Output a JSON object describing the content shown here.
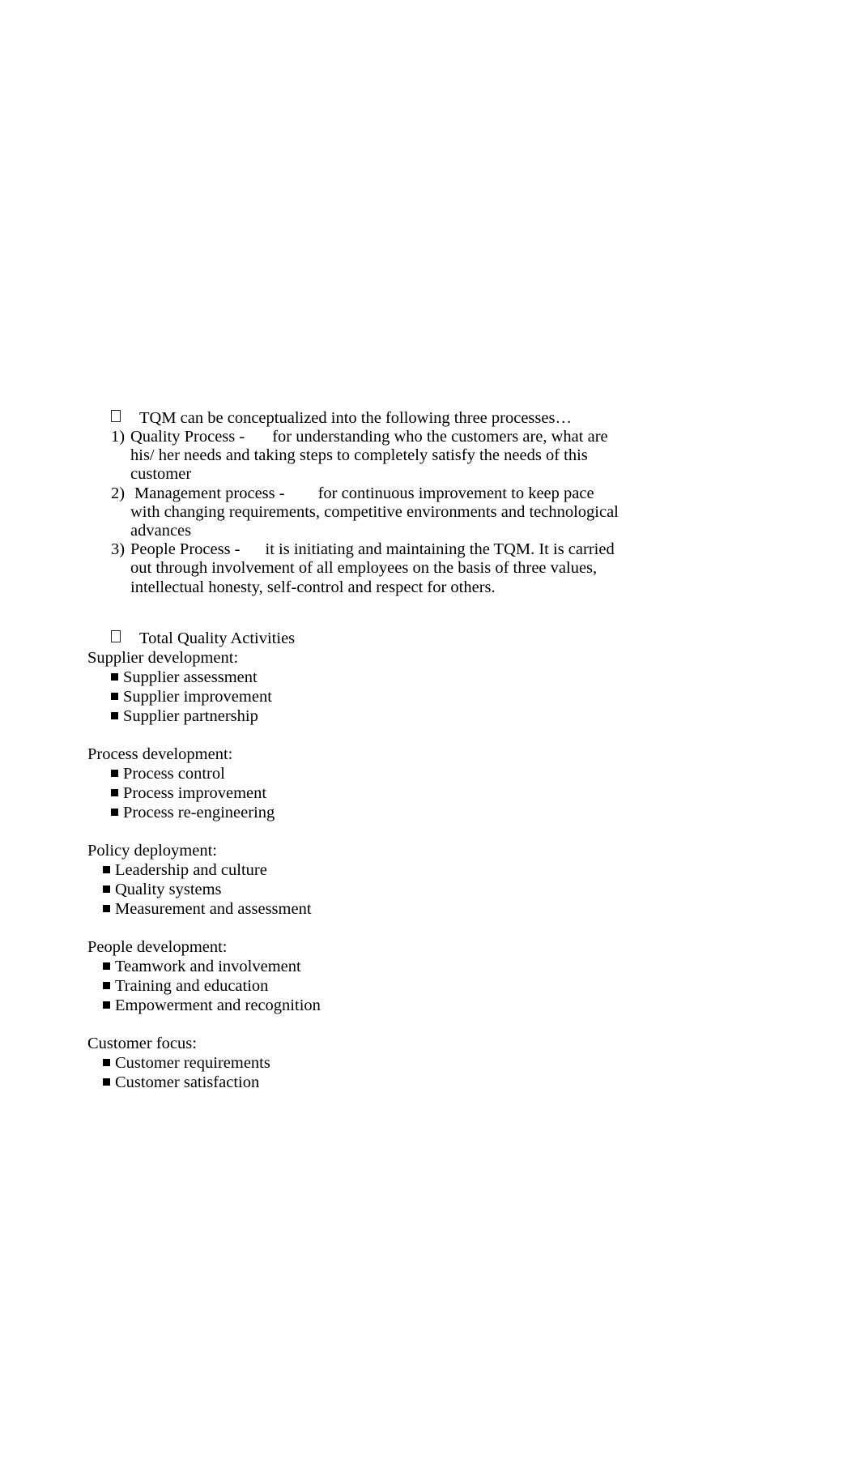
{
  "document": {
    "intro_bullet": {
      "marker": "placeholder-box-glyph",
      "text": "TQM can be conceptualized into the following three processes…"
    },
    "numbered_items": [
      {
        "marker": "1)",
        "lead": "Quality Process -",
        "rest": "for understanding who the customers are, what are his/ her",
        "continuation": "needs and taking steps to completely satisfy the needs of this customer"
      },
      {
        "marker": "2)",
        "lead": "Management process -",
        "rest": "for continuous improvement to keep pace with",
        "continuation": "changing requirements, competitive environments and technological advances"
      },
      {
        "marker": "3)",
        "lead": "People Process -",
        "rest": "it is initiating and maintaining the TQM. It is carried out",
        "continuation": "through involvement of all employees on the basis of three values, intellectual",
        "continuation2": "honesty, self-control and respect for others."
      }
    ],
    "activities_bullet": {
      "marker": "placeholder-box-glyph",
      "text": "Total Quality Activities"
    },
    "groups": [
      {
        "heading": "Supplier development:",
        "items": [
          "Supplier assessment",
          "Supplier improvement",
          "Supplier partnership"
        ]
      },
      {
        "heading": "Process development:",
        "items": [
          "Process control",
          "Process improvement",
          "Process re-engineering"
        ]
      },
      {
        "heading": "Policy deployment:",
        "items": [
          "Leadership and culture",
          "Quality systems",
          "Measurement and assessment"
        ]
      },
      {
        "heading": "People development:",
        "items": [
          "Teamwork and involvement",
          "Training and education",
          "Empowerment and recognition"
        ]
      },
      {
        "heading": "Customer focus:",
        "items": [
          "Customer requirements",
          "Customer satisfaction"
        ]
      }
    ]
  },
  "colors": {
    "page_background": "#ffffff",
    "text": "#000000"
  }
}
